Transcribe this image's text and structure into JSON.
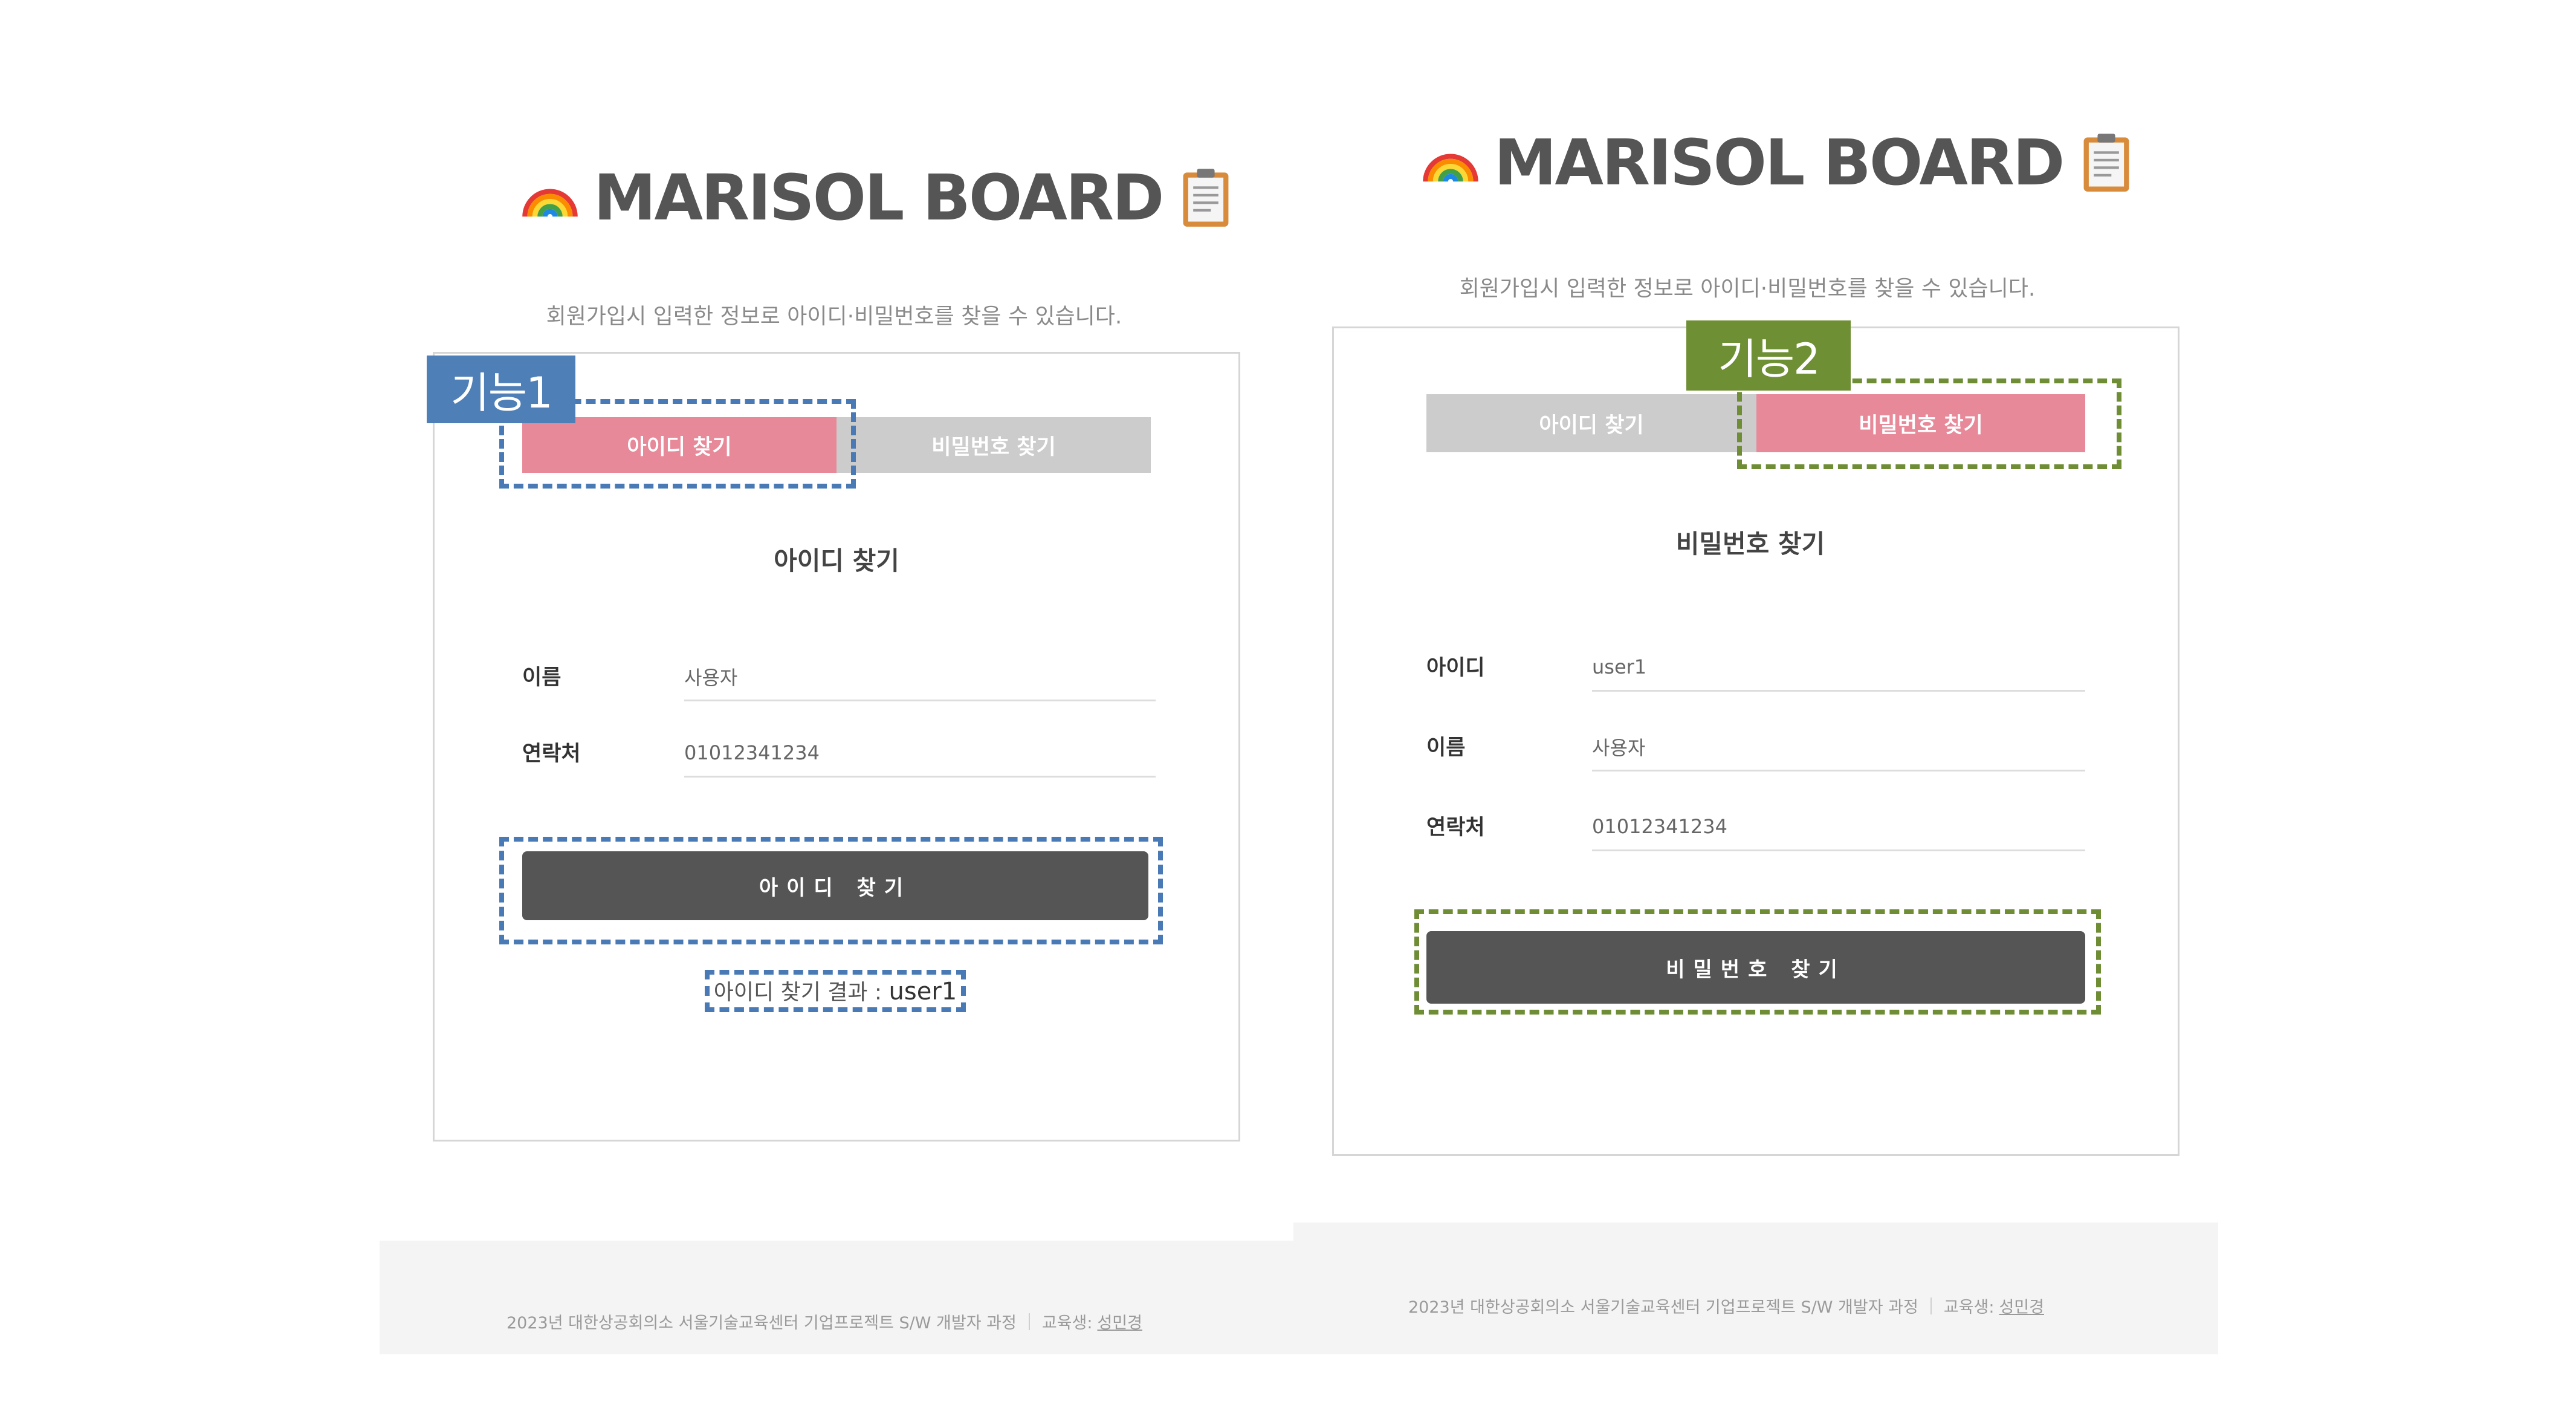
{
  "brand": {
    "title": "MARISOL BOARD",
    "left_icon": "rainbow-icon",
    "right_icon": "clipboard-icon"
  },
  "subtitle": "회원가입시 입력한 정보로 아이디·비밀번호를 찾을 수 있습니다.",
  "tabs": {
    "find_id": "아이디 찾기",
    "find_password": "비밀번호 찾기"
  },
  "panel_left": {
    "badge": "기능1",
    "section_title": "아이디 찾기",
    "name_label": "이름",
    "name_value": "사용자",
    "phone_label": "연락처",
    "phone_value": "01012341234",
    "submit_label": "아이디 찾기",
    "result_prefix": "아이디 찾기 결과 : ",
    "result_value": "user1"
  },
  "panel_right": {
    "badge": "기능2",
    "section_title": "비밀번호 찾기",
    "id_label": "아이디",
    "id_value": "user1",
    "name_label": "이름",
    "name_value": "사용자",
    "phone_label": "연락처",
    "phone_value": "01012341234",
    "submit_label": "비밀번호 찾기"
  },
  "footer": {
    "text": "2023년 대한상공회의소 서울기술교육센터 기업프로젝트 S/W 개발자 과정",
    "author_prefix": "교육생:",
    "author_name": "성민경"
  },
  "colors": {
    "active_tab": "#e8899a",
    "inactive_tab": "#cccccc",
    "primary_button": "#555555",
    "annotation_blue": "#4a7ab5",
    "annotation_green": "#6e8d35"
  }
}
